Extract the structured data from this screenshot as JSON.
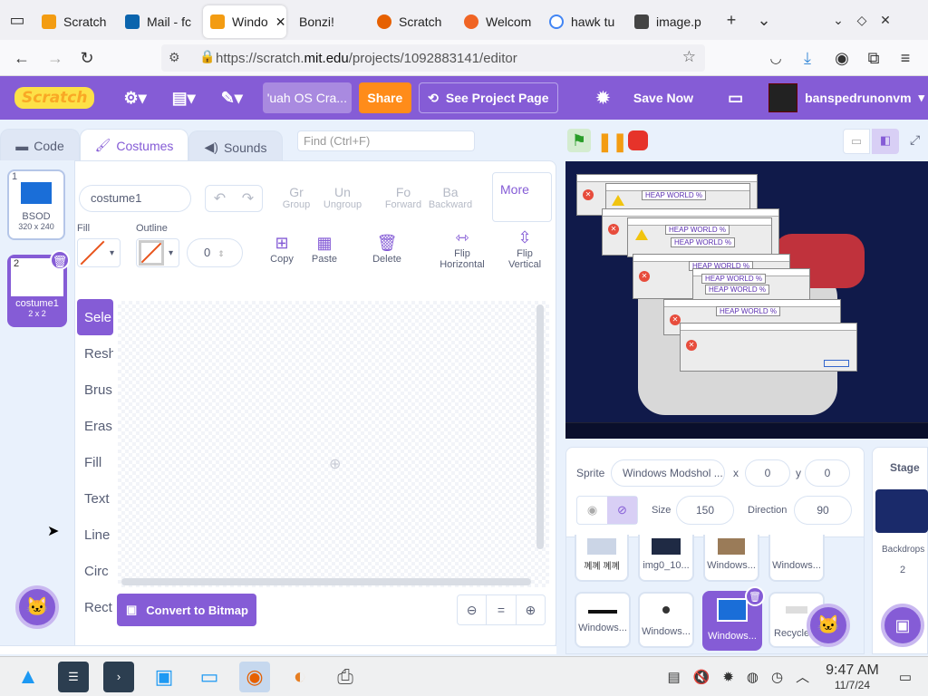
{
  "browser": {
    "tabs": [
      {
        "label": "Scratch",
        "color": "#f39c12"
      },
      {
        "label": "Mail - fc",
        "color": "#0a64ad"
      },
      {
        "label": "Windo",
        "color": "#f39c12",
        "active": true
      },
      {
        "label": "Bonzi!",
        "color": ""
      },
      {
        "label": "Scratch",
        "color": "#e66000"
      },
      {
        "label": "Welcom",
        "color": "#f06424"
      },
      {
        "label": "hawk tu",
        "color": "#4285f4"
      },
      {
        "label": "image.p",
        "color": "#444"
      }
    ],
    "url_prefix": "https://scratch.",
    "url_domain": "mit.edu",
    "url_path": "/projects/1092883141/editor"
  },
  "menu": {
    "logo": "Scratch",
    "project_title": "'uah OS Cra...",
    "share": "Share",
    "see_project": "See Project Page",
    "save_now": "Save Now",
    "username": "banspedrunonvm"
  },
  "tabs": {
    "code": "Code",
    "costumes": "Costumes",
    "sounds": "Sounds"
  },
  "find_placeholder": "Find (Ctrl+F)",
  "costumes": [
    {
      "num": "1",
      "name": "BSOD",
      "size": "320 x 240"
    },
    {
      "num": "2",
      "name": "costume1",
      "size": "2 x 2"
    }
  ],
  "paint": {
    "costume_name": "costume1",
    "group": "Group",
    "group_short": "Gr",
    "ungroup": "Ungroup",
    "ungroup_short": "Un",
    "forward": "Forward",
    "forward_short": "Fo",
    "backward": "Backward",
    "backward_short": "Ba",
    "more": "More",
    "fill_label": "Fill",
    "outline_label": "Outline",
    "outline_width": "0",
    "copy": "Copy",
    "paste": "Paste",
    "delete": "Delete",
    "flip_h": "Flip Horizontal",
    "flip_v": "Flip Vertical",
    "tools": [
      "Sele",
      "Resh",
      "Brus",
      "Eras",
      "Fill",
      "Text",
      "Line",
      "Circ",
      "Rect"
    ],
    "convert": "Convert to Bitmap",
    "zoom_reset": "="
  },
  "sprite_info": {
    "sprite_label": "Sprite",
    "sprite_name": "Windows Modshol ...",
    "x_label": "x",
    "x": "0",
    "y_label": "y",
    "y": "0",
    "size_label": "Size",
    "size": "150",
    "direction_label": "Direction",
    "direction": "90"
  },
  "sprites": [
    {
      "name": "꼐꼐 꼐꼐"
    },
    {
      "name": "img0_10..."
    },
    {
      "name": "Windows..."
    },
    {
      "name": "Windows..."
    },
    {
      "name": "Windows..."
    },
    {
      "name": "Windows..."
    },
    {
      "name": "Windows..."
    },
    {
      "name": "Recycle ..."
    }
  ],
  "stage_panel": {
    "title": "Stage",
    "backdrops_label": "Backdrops",
    "backdrops_count": "2"
  },
  "stage_popups": {
    "heap": "HEAP WORLD %"
  },
  "taskbar": {
    "time": "9:47 AM",
    "date": "11/7/24"
  }
}
